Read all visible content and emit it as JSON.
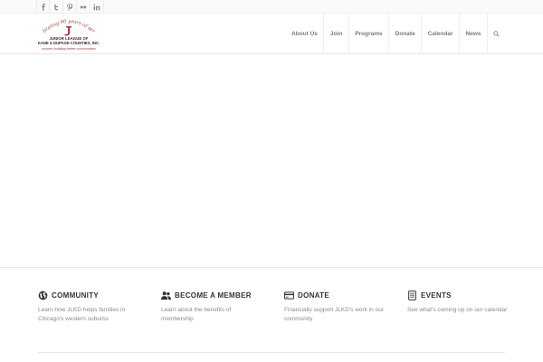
{
  "social": [
    {
      "icon": "facebook-icon",
      "label": "f"
    },
    {
      "icon": "twitter-icon",
      "label": "t"
    },
    {
      "icon": "pinterest-icon",
      "label": "p"
    },
    {
      "icon": "flickr-icon",
      "label": "••"
    },
    {
      "icon": "linkedin-icon",
      "label": "in"
    }
  ],
  "logo": {
    "arc_text": "celebrating 90 years of service",
    "line1": "JUNIOR LEAGUE OF",
    "line2": "KANE & DUPAGE COUNTIES, INC.",
    "tagline": "women building better communities",
    "color": "#a23b3b"
  },
  "nav": {
    "items": [
      "About Us",
      "Join",
      "Programs",
      "Donate",
      "Calendar",
      "News"
    ],
    "search_icon": "search-icon"
  },
  "features": [
    {
      "icon": "globe-icon",
      "title": "COMMUNITY",
      "text": "Learn how JLKD helps families in Chicago's western suburbs"
    },
    {
      "icon": "users-icon",
      "title": "BECOME A MEMBER",
      "text": "Learn about the benefits of membership"
    },
    {
      "icon": "credit-card-icon",
      "title": "DONATE",
      "text": "Financially support JLKD's work in our community"
    },
    {
      "icon": "document-icon",
      "title": "EVENTS",
      "text": "See what's coming up on our calendar"
    }
  ],
  "colors": {
    "nav_text": "#7a7a7a",
    "title_text": "#333333",
    "body_text": "#8a8a8a",
    "brand": "#a23b3b"
  }
}
